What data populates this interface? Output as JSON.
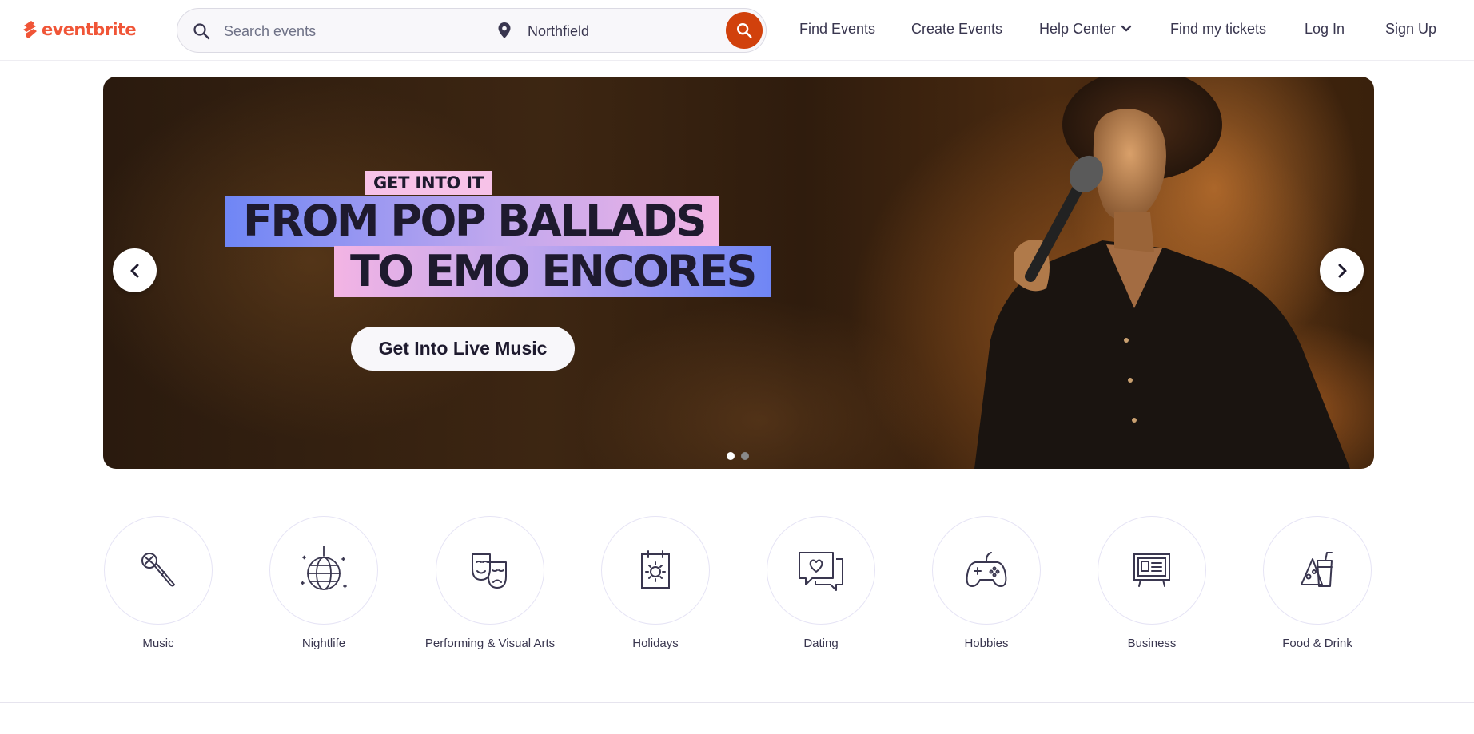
{
  "brand": {
    "name": "eventbrite",
    "color": "#f05537"
  },
  "search": {
    "placeholder": "Search events",
    "location_value": "Northfield",
    "icon": "search-icon",
    "location_icon": "location-pin-icon",
    "button_color": "#d1410c"
  },
  "nav": {
    "find_events": "Find Events",
    "create_events": "Create Events",
    "help_center": "Help Center",
    "find_tickets": "Find my tickets",
    "log_in": "Log In",
    "sign_up": "Sign Up"
  },
  "hero": {
    "eyebrow": "GET INTO IT",
    "headline_line1": "FROM POP BALLADS",
    "headline_line2": "TO EMO ENCORES",
    "cta": "Get Into Live Music",
    "slide_count": 2,
    "active_slide": 1
  },
  "categories": [
    {
      "label": "Music",
      "icon": "microphone-icon"
    },
    {
      "label": "Nightlife",
      "icon": "disco-ball-icon"
    },
    {
      "label": "Performing & Visual Arts",
      "icon": "theater-masks-icon"
    },
    {
      "label": "Holidays",
      "icon": "calendar-sun-icon"
    },
    {
      "label": "Dating",
      "icon": "chat-heart-icon"
    },
    {
      "label": "Hobbies",
      "icon": "game-controller-icon"
    },
    {
      "label": "Business",
      "icon": "presentation-board-icon"
    },
    {
      "label": "Food & Drink",
      "icon": "food-drink-icon"
    }
  ]
}
